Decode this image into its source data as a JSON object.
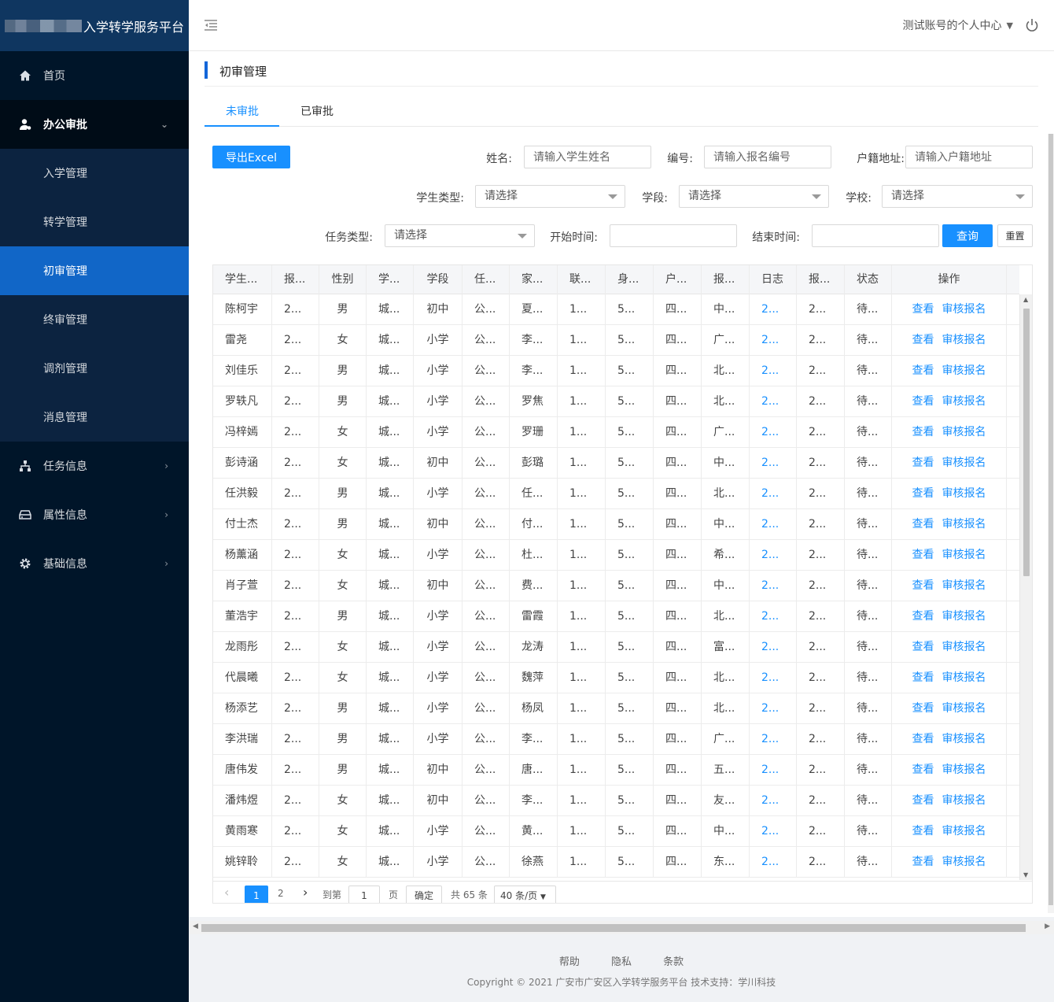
{
  "brand": {
    "title": "入学转学服务平台"
  },
  "header": {
    "user_center": "测试账号的个人中心"
  },
  "sidebar": {
    "items": [
      {
        "label": "首页",
        "icon": "home-icon"
      },
      {
        "label": "办公审批",
        "icon": "user-approval-icon"
      },
      {
        "label": "任务信息",
        "icon": "sitemap-icon"
      },
      {
        "label": "属性信息",
        "icon": "drive-icon"
      },
      {
        "label": "基础信息",
        "icon": "gear-icon"
      }
    ],
    "sub_items": [
      "入学管理",
      "转学管理",
      "初审管理",
      "终审管理",
      "调剂管理",
      "消息管理"
    ]
  },
  "page": {
    "title": "初审管理"
  },
  "tabs": [
    "未审批",
    "已审批"
  ],
  "toolbar": {
    "export_label": "导出Excel",
    "query_label": "查询",
    "reset_label": "重置"
  },
  "filters": {
    "name_label": "姓名:",
    "name_placeholder": "请输入学生姓名",
    "code_label": "编号:",
    "code_placeholder": "请输入报名编号",
    "address_label": "户籍地址:",
    "address_placeholder": "请输入户籍地址",
    "student_type_label": "学生类型:",
    "student_type_value": "请选择",
    "stage_label": "学段:",
    "stage_value": "请选择",
    "school_label": "学校:",
    "school_value": "请选择",
    "task_type_label": "任务类型:",
    "task_type_value": "请选择",
    "start_label": "开始时间:",
    "end_label": "结束时间:"
  },
  "table": {
    "headers": [
      "学生...",
      "报...",
      "性别",
      "学...",
      "学段",
      "任...",
      "家...",
      "联...",
      "身...",
      "户...",
      "报...",
      "日志",
      "报...",
      "状态",
      "操作"
    ],
    "op_view": "查看",
    "op_review": "审核报名",
    "rows": [
      [
        "陈柯宇",
        "2...",
        "男",
        "城...",
        "初中",
        "公...",
        "夏...",
        "1...",
        "5...",
        "四...",
        "中...",
        "2...",
        "2...",
        "待..."
      ],
      [
        "雷尧",
        "2...",
        "女",
        "城...",
        "小学",
        "公...",
        "李...",
        "1...",
        "5...",
        "四...",
        "广...",
        "2...",
        "2...",
        "待..."
      ],
      [
        "刘佳乐",
        "2...",
        "男",
        "城...",
        "小学",
        "公...",
        "李...",
        "1...",
        "5...",
        "四...",
        "北...",
        "2...",
        "2...",
        "待..."
      ],
      [
        "罗轶凡",
        "2...",
        "男",
        "城...",
        "小学",
        "公...",
        "罗焦",
        "1...",
        "5...",
        "四...",
        "北...",
        "2...",
        "2...",
        "待..."
      ],
      [
        "冯梓嫣",
        "2...",
        "女",
        "城...",
        "小学",
        "公...",
        "罗珊",
        "1...",
        "5...",
        "四...",
        "广...",
        "2...",
        "2...",
        "待..."
      ],
      [
        "彭诗涵",
        "2...",
        "女",
        "城...",
        "初中",
        "公...",
        "彭璐",
        "1...",
        "5...",
        "四...",
        "中...",
        "2...",
        "2...",
        "待..."
      ],
      [
        "任洪毅",
        "2...",
        "男",
        "城...",
        "小学",
        "公...",
        "任...",
        "1...",
        "5...",
        "四...",
        "北...",
        "2...",
        "2...",
        "待..."
      ],
      [
        "付士杰",
        "2...",
        "男",
        "城...",
        "初中",
        "公...",
        "付...",
        "1...",
        "5...",
        "四...",
        "中...",
        "2...",
        "2...",
        "待..."
      ],
      [
        "杨薰涵",
        "2...",
        "女",
        "城...",
        "小学",
        "公...",
        "杜...",
        "1...",
        "5...",
        "四...",
        "希...",
        "2...",
        "2...",
        "待..."
      ],
      [
        "肖子萱",
        "2...",
        "女",
        "城...",
        "初中",
        "公...",
        "费...",
        "1...",
        "5...",
        "四...",
        "中...",
        "2...",
        "2...",
        "待..."
      ],
      [
        "董浩宇",
        "2...",
        "男",
        "城...",
        "小学",
        "公...",
        "雷霞",
        "1...",
        "5...",
        "四...",
        "北...",
        "2...",
        "2...",
        "待..."
      ],
      [
        "龙雨彤",
        "2...",
        "女",
        "城...",
        "小学",
        "公...",
        "龙涛",
        "1...",
        "5...",
        "四...",
        "富...",
        "2...",
        "2...",
        "待..."
      ],
      [
        "代晨曦",
        "2...",
        "女",
        "城...",
        "小学",
        "公...",
        "魏萍",
        "1...",
        "5...",
        "四...",
        "北...",
        "2...",
        "2...",
        "待..."
      ],
      [
        "杨添艺",
        "2...",
        "男",
        "城...",
        "小学",
        "公...",
        "杨凤",
        "1...",
        "5...",
        "四...",
        "北...",
        "2...",
        "2...",
        "待..."
      ],
      [
        "李洪瑞",
        "2...",
        "男",
        "城...",
        "小学",
        "公...",
        "李...",
        "1...",
        "5...",
        "四...",
        "广...",
        "2...",
        "2...",
        "待..."
      ],
      [
        "唐伟发",
        "2...",
        "男",
        "城...",
        "初中",
        "公...",
        "唐...",
        "1...",
        "5...",
        "四...",
        "五...",
        "2...",
        "2...",
        "待..."
      ],
      [
        "潘炜煜",
        "2...",
        "女",
        "城...",
        "初中",
        "公...",
        "李...",
        "1...",
        "5...",
        "四...",
        "友...",
        "2...",
        "2...",
        "待..."
      ],
      [
        "黄雨寒",
        "2...",
        "女",
        "城...",
        "小学",
        "公...",
        "黄...",
        "1...",
        "5...",
        "四...",
        "中...",
        "2...",
        "2...",
        "待..."
      ],
      [
        "姚锌聆",
        "2...",
        "女",
        "城...",
        "小学",
        "公...",
        "徐燕",
        "1...",
        "5...",
        "四...",
        "东...",
        "2...",
        "2...",
        "待..."
      ]
    ]
  },
  "pagination": {
    "current": "1",
    "page2": "2",
    "goto_label": "到第",
    "goto_value": "1",
    "page_unit": "页",
    "confirm": "确定",
    "total": "共 65 条",
    "page_size": "40 条/页"
  },
  "footer": {
    "links": [
      "帮助",
      "隐私",
      "条款"
    ],
    "copyright": "Copyright © 2021   广安市广安区入学转学服务平台   技术支持：学川科技"
  },
  "colors": {
    "sidebar_bg": "#001529",
    "accent": "#1890ff",
    "active_menu": "#1166c7"
  }
}
